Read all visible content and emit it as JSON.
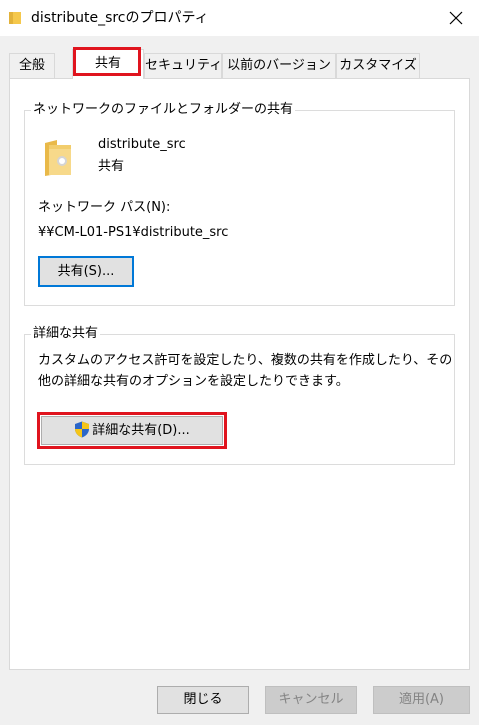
{
  "window": {
    "title": "distribute_srcのプロパティ"
  },
  "tabs": [
    {
      "label": "全般"
    },
    {
      "label": "共有",
      "active": true
    },
    {
      "label": "セキュリティ"
    },
    {
      "label": "以前のバージョン"
    },
    {
      "label": "カスタマイズ"
    }
  ],
  "network_share": {
    "group_title": "ネットワークのファイルとフォルダーの共有",
    "folder_name": "distribute_src",
    "status": "共有",
    "path_label": "ネットワーク パス(N):",
    "path_value": "¥¥CM-L01-PS1¥distribute_src",
    "share_button": "共有(S)..."
  },
  "advanced_share": {
    "group_title": "詳細な共有",
    "description_line1": "カスタムのアクセス許可を設定したり、複数の共有を作成したり、その",
    "description_line2": "他の詳細な共有のオプションを設定したりできます。",
    "button_label": "詳細な共有(D)..."
  },
  "footer": {
    "close": "閉じる",
    "cancel": "キャンセル",
    "apply": "適用(A)"
  },
  "colors": {
    "highlight": "#e0141e",
    "default_button_border": "#0078d7",
    "folder": "#f5d27a"
  }
}
